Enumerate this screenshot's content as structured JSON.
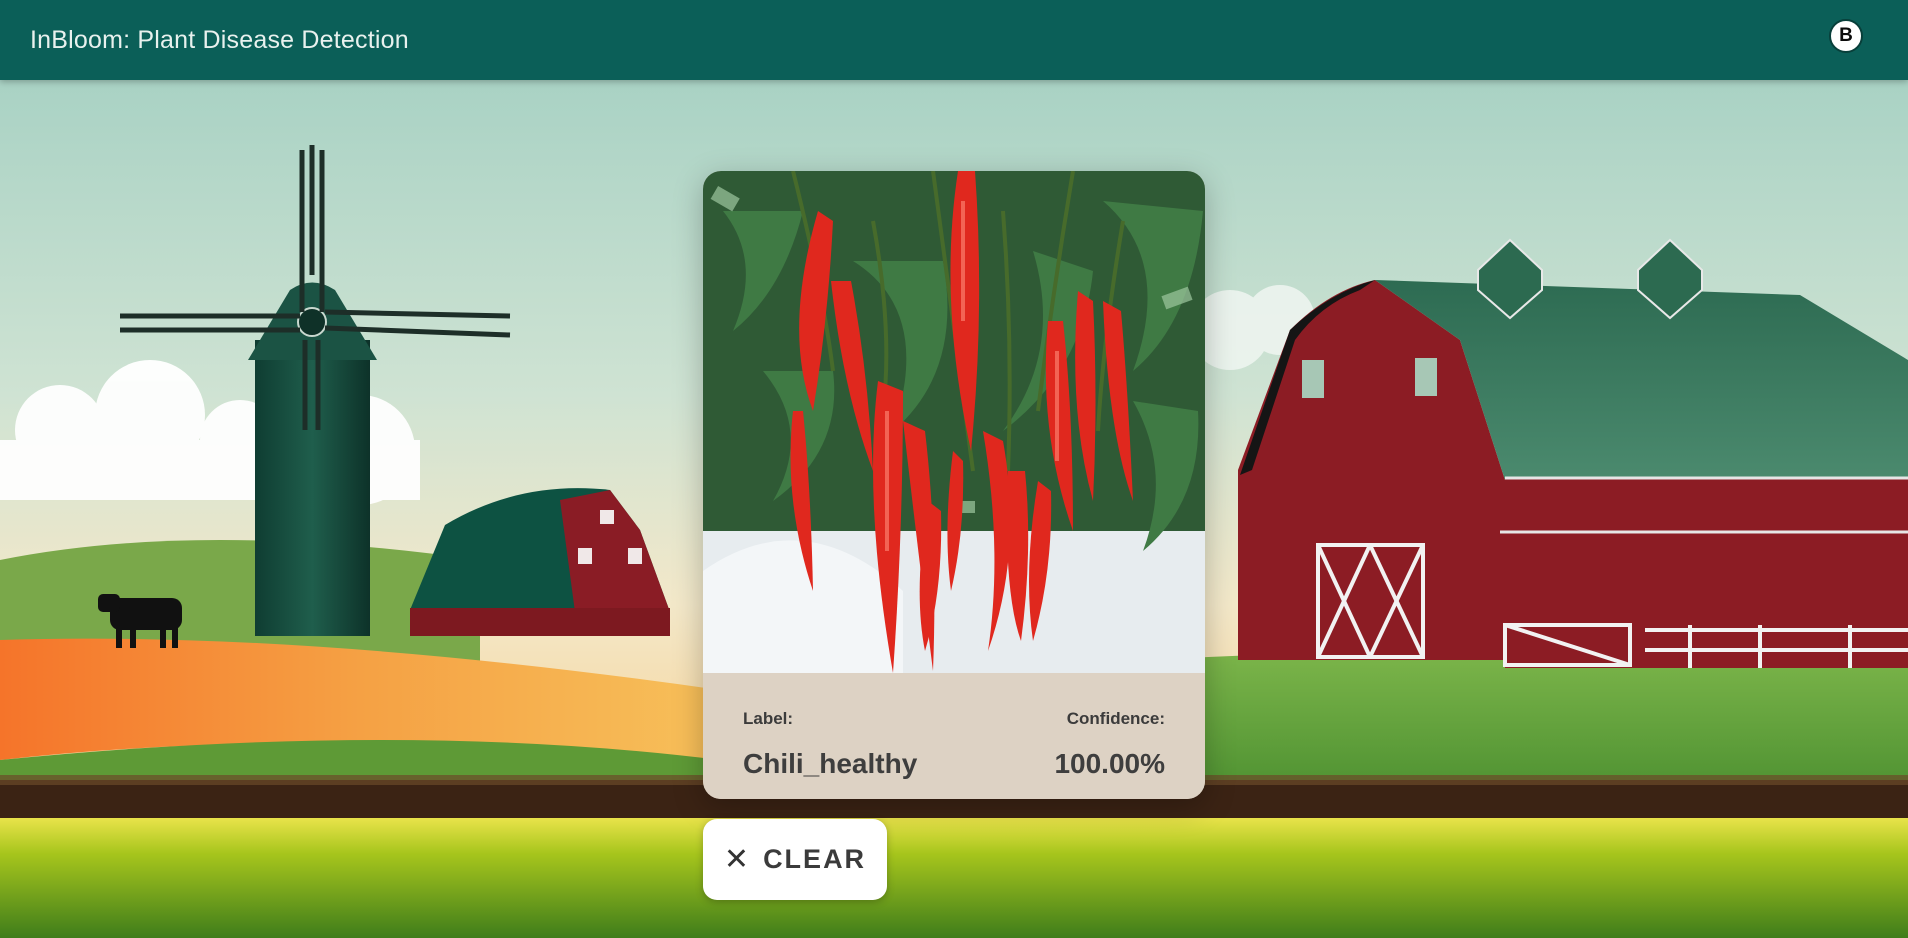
{
  "header": {
    "title": "InBloom: Plant Disease Detection",
    "avatar_letter": "B"
  },
  "result": {
    "label_heading": "Label:",
    "label_value": "Chili_healthy",
    "confidence_heading": "Confidence:",
    "confidence_value": "100.00%"
  },
  "actions": {
    "clear_label": "CLEAR",
    "clear_icon": "close-icon"
  },
  "colors": {
    "header_bg": "#0b5f58",
    "barn_red": "#8c1c24",
    "barn_roof": "#2d6b52",
    "result_panel_bg": "#ddd2c4"
  }
}
